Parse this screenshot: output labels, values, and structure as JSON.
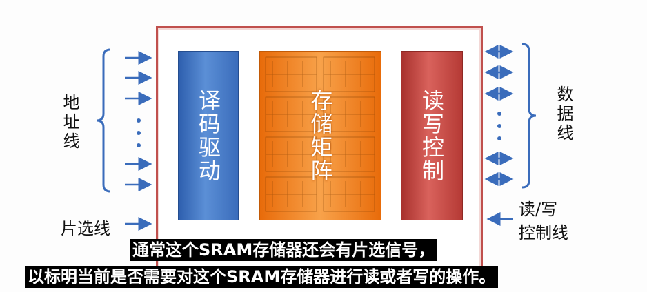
{
  "diagram": {
    "blocks": {
      "decoder": "译码驱动",
      "matrix": "存储矩阵",
      "read_write": "读写控制"
    },
    "labels": {
      "address_lines": "地址线",
      "chip_select": "片选线",
      "data_lines": "数据线",
      "rw_control_line1": "读/写",
      "rw_control_line2": "控制线"
    },
    "colors": {
      "chip_border": "#c0504d",
      "decoder": "#3a6cbb",
      "matrix": "#f08a24",
      "read_write": "#c0504d",
      "arrows": "#3a6cbb"
    }
  },
  "subtitles": {
    "line1": "通常这个SRAM存储器还会有片选信号，",
    "line2": "以标明当前是否需要对这个SRAM存储器进行读或者写的操作。"
  }
}
